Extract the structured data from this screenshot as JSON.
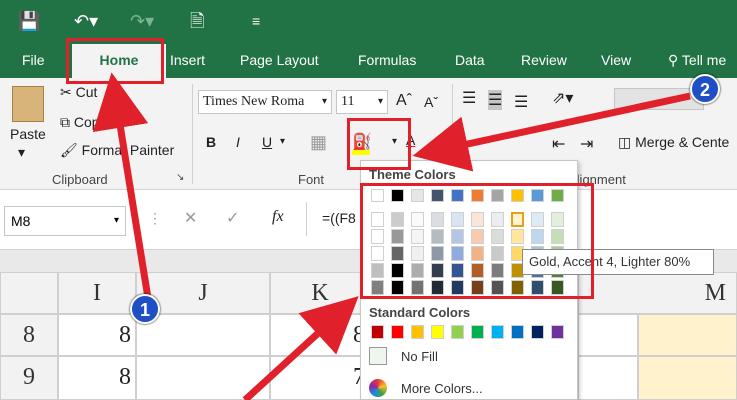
{
  "tabs": {
    "file": "File",
    "home": "Home",
    "insert": "Insert",
    "page_layout": "Page Layout",
    "formulas": "Formulas",
    "data": "Data",
    "review": "Review",
    "view": "View",
    "tell_me": "Tell me"
  },
  "ribbon": {
    "paste": "Paste",
    "cut": "Cut",
    "copy": "Copy",
    "format_painter": "Format Painter",
    "clipboard_label": "Clipboard",
    "font_name": "Times New Roma",
    "font_size": "11",
    "font_label": "Font",
    "bold": "B",
    "italic": "I",
    "underline": "U",
    "merge_center": "Merge & Cente",
    "alignment_label": "Alignment"
  },
  "formula_bar": {
    "name_box": "M8",
    "fx": "fx",
    "formula": "=((F8"
  },
  "columns": [
    "I",
    "J",
    "K",
    "M"
  ],
  "rows": [
    {
      "num": "8",
      "i": "8",
      "k": "8"
    },
    {
      "num": "9",
      "i": "8",
      "k": "7"
    }
  ],
  "dropdown": {
    "theme_colors": "Theme Colors",
    "standard_colors": "Standard Colors",
    "no_fill": "No Fill",
    "more_colors": "More Colors..."
  },
  "tooltip": "Gold, Accent 4, Lighter 80%",
  "badges": [
    "1",
    "2"
  ],
  "colors": {
    "accent": "#217346",
    "highlight": "#e0202a",
    "badge": "#1f4fc4",
    "theme_top": [
      "#ffffff",
      "#000000",
      "#e7e6e6",
      "#44546a",
      "#4472c4",
      "#ed7d31",
      "#a5a5a5",
      "#ffc000",
      "#5b9bd5",
      "#70ad47"
    ],
    "standard": [
      "#c00000",
      "#ff0000",
      "#ffc000",
      "#ffff00",
      "#92d050",
      "#00b050",
      "#00b0f0",
      "#0070c0",
      "#002060",
      "#7030a0"
    ]
  }
}
